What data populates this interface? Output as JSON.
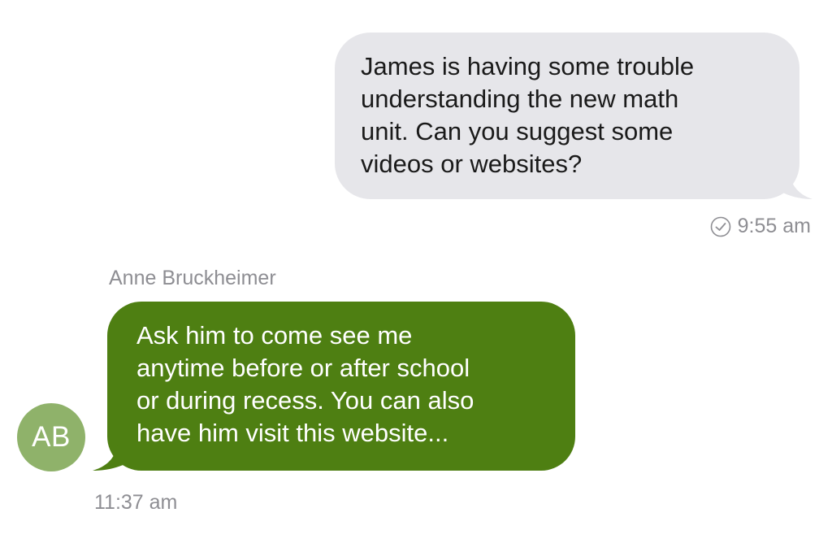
{
  "messages": {
    "outgoing": {
      "text": "James is having some trouble\nunderstanding the new math\nunit. Can you suggest some\nvideos or websites?",
      "time": "9:55 am",
      "status_icon": "check-circle-icon"
    },
    "incoming": {
      "sender_name": "Anne Bruckheimer",
      "avatar_initials": "AB",
      "text": "Ask him to come see me\nanytime before or after school\nor during recess. You can also\nhave him visit this website...",
      "time": "11:37 am"
    }
  },
  "colors": {
    "outgoing_bubble": "#e6e6ea",
    "incoming_bubble": "#4e7f12",
    "avatar": "#8fb26a",
    "meta_text": "#8e8e93"
  }
}
